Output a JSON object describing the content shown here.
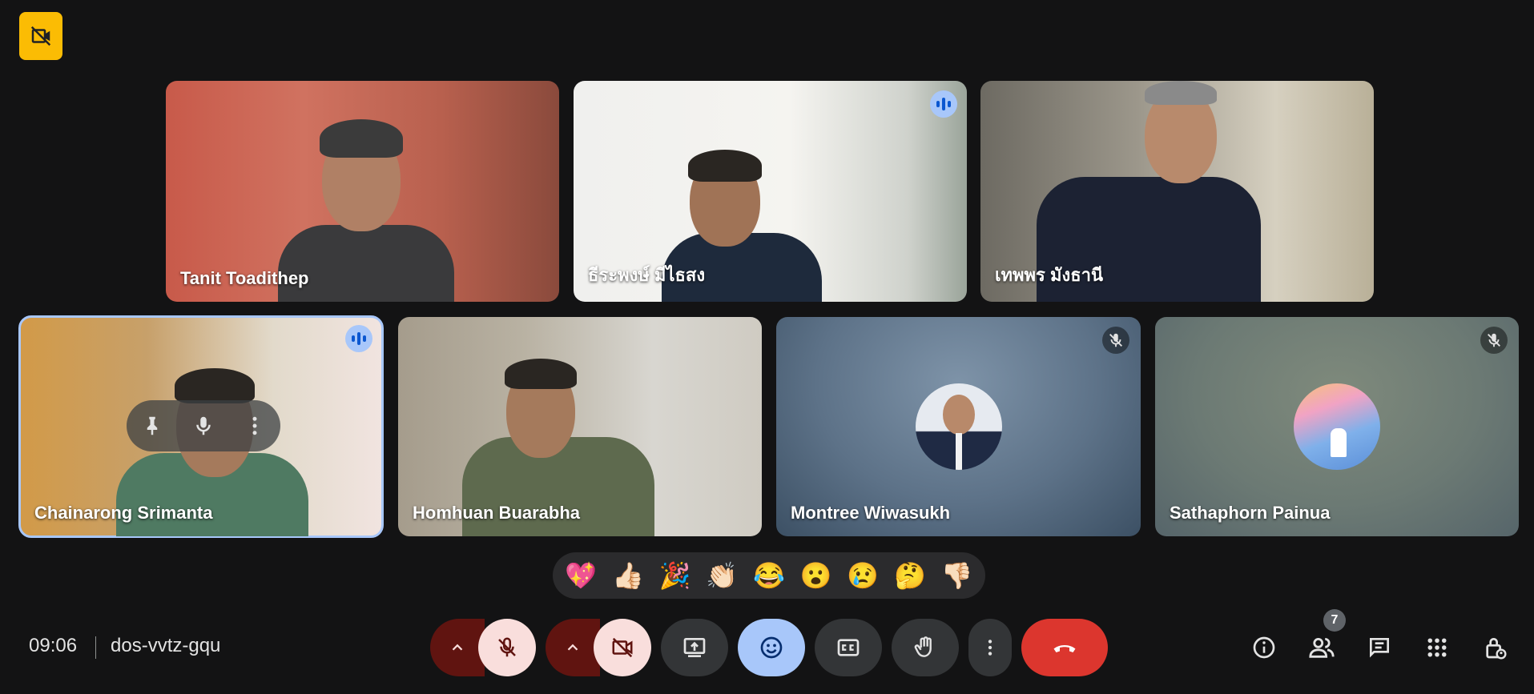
{
  "participants": [
    {
      "name": "Tanit Toadithep"
    },
    {
      "name": "ธีระพงษ์ มีไธสง"
    },
    {
      "name": "เทพพร มังธานี"
    },
    {
      "name": "Chainarong Srimanta"
    },
    {
      "name": "Homhuan Buarabha"
    },
    {
      "name": "Montree Wiwasukh"
    },
    {
      "name": "Sathaphorn Painua"
    }
  ],
  "reactions": [
    "💖",
    "👍🏻",
    "🎉",
    "👏🏻",
    "😂",
    "😮",
    "😢",
    "🤔",
    "👎🏻"
  ],
  "meeting": {
    "time": "09:06",
    "code": "dos-vvtz-gqu"
  },
  "people_count": "7",
  "colors": {
    "background": "#131314",
    "speaking_ring": "#a8c7fa",
    "end_call": "#dc362e",
    "muted_button": "#f9dedc",
    "reaction_active": "#a8c7fa",
    "badge": "#fbbc04"
  },
  "icons": [
    "no-recording-icon",
    "speaking-icon",
    "mic-off-icon",
    "pin-icon",
    "mic-icon",
    "more-vert-icon",
    "chevron-up-icon",
    "camera-off-icon",
    "present-icon",
    "emoji-icon",
    "captions-icon",
    "raise-hand-icon",
    "more-options-icon",
    "end-call-icon",
    "info-icon",
    "people-icon",
    "chat-icon",
    "activities-icon",
    "host-controls-icon"
  ]
}
